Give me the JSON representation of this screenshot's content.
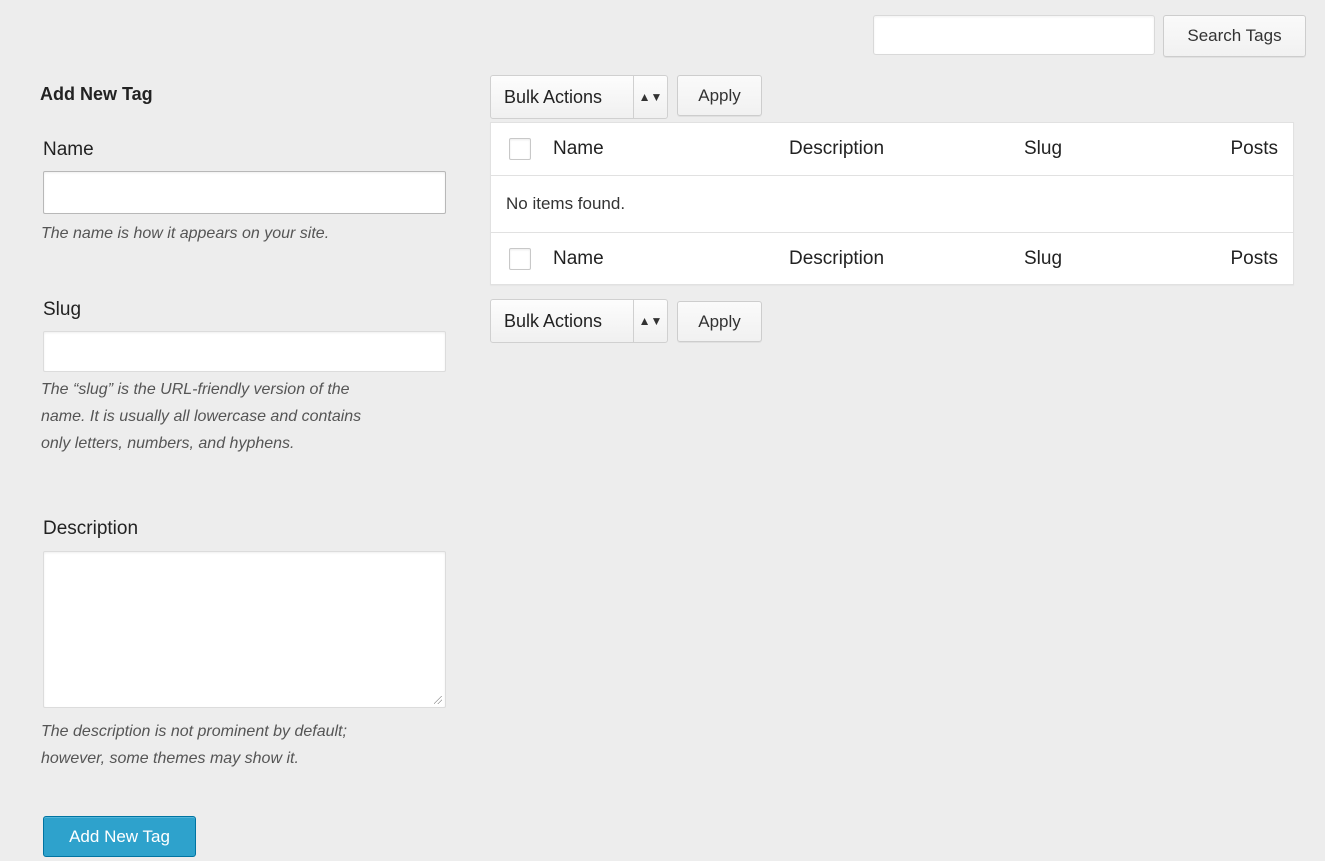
{
  "search": {
    "button_label": "Search Tags",
    "value": ""
  },
  "form": {
    "title": "Add New Tag",
    "name": {
      "label": "Name",
      "value": "",
      "help": "The name is how it appears on your site."
    },
    "slug": {
      "label": "Slug",
      "value": "",
      "help_lines": [
        "The “slug” is the URL-friendly version of the",
        "name. It is usually all lowercase and contains",
        "only letters, numbers, and hyphens."
      ]
    },
    "description": {
      "label": "Description",
      "value": "",
      "help_lines": [
        "The description is not prominent by default;",
        "however, some themes may show it."
      ]
    },
    "submit_label": "Add New Tag"
  },
  "bulk_top": {
    "selected": "Bulk Actions",
    "apply_label": "Apply"
  },
  "bulk_bottom": {
    "selected": "Bulk Actions",
    "apply_label": "Apply"
  },
  "table": {
    "columns": [
      "Name",
      "Description",
      "Slug",
      "Posts"
    ],
    "empty_message": "No items found."
  },
  "colors": {
    "primary_button": "#2ea2cc",
    "background": "#ededed"
  }
}
